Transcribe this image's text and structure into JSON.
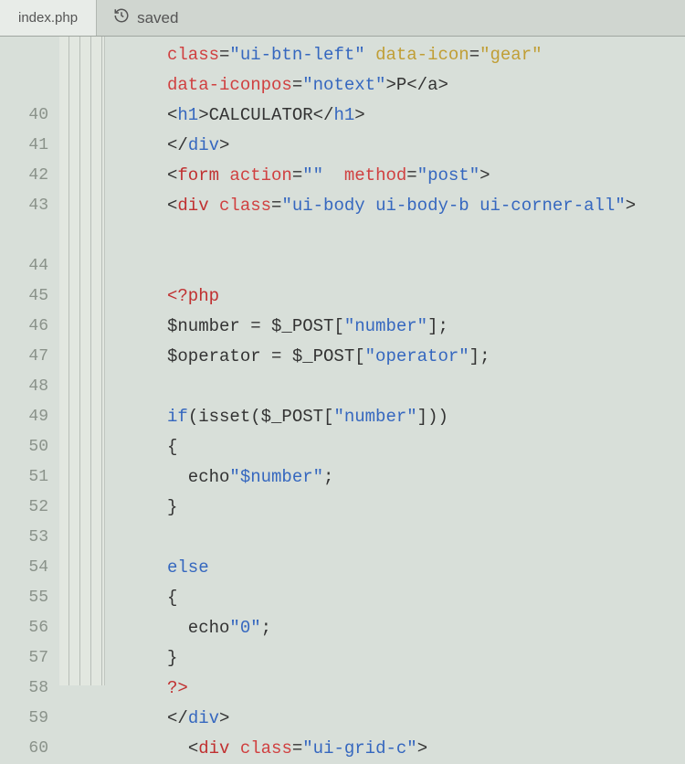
{
  "tab": {
    "filename": "index.php"
  },
  "status": {
    "label": "saved"
  },
  "gutter": {
    "blanks_before": 2,
    "start": 40,
    "end": 60
  },
  "code": {
    "lines": [
      {
        "n": null,
        "frags": [
          {
            "c": "tok-attr",
            "t": "class"
          },
          {
            "c": "tok-punct",
            "t": "="
          },
          {
            "c": "tok-val",
            "t": "\"ui-btn-left\""
          },
          {
            "c": "tok-punct",
            "t": " "
          },
          {
            "c": "tok-attr2",
            "t": "data-icon"
          },
          {
            "c": "tok-punct",
            "t": "="
          },
          {
            "c": "tok-attr2",
            "t": "\"gear\""
          }
        ]
      },
      {
        "n": null,
        "frags": [
          {
            "c": "tok-attr",
            "t": "data-iconpos"
          },
          {
            "c": "tok-punct",
            "t": "="
          },
          {
            "c": "tok-val",
            "t": "\"notext\""
          },
          {
            "c": "tok-bracket",
            "t": ">"
          },
          {
            "c": "tok-text",
            "t": "P"
          },
          {
            "c": "tok-bracket",
            "t": "</"
          },
          {
            "c": "tok-text",
            "t": "a"
          },
          {
            "c": "tok-bracket",
            "t": ">"
          }
        ]
      },
      {
        "n": 40,
        "frags": [
          {
            "c": "tok-bracket",
            "t": "<"
          },
          {
            "c": "tok-tag",
            "t": "h1"
          },
          {
            "c": "tok-bracket",
            "t": ">"
          },
          {
            "c": "tok-text",
            "t": "CALCULATOR"
          },
          {
            "c": "tok-bracket",
            "t": "</"
          },
          {
            "c": "tok-tag",
            "t": "h1"
          },
          {
            "c": "tok-bracket",
            "t": ">"
          }
        ]
      },
      {
        "n": 41,
        "frags": [
          {
            "c": "tok-bracket",
            "t": "</"
          },
          {
            "c": "tok-tag",
            "t": "div"
          },
          {
            "c": "tok-bracket",
            "t": ">"
          }
        ]
      },
      {
        "n": 42,
        "frags": [
          {
            "c": "tok-bracket",
            "t": "<"
          },
          {
            "c": "tok-tagname",
            "t": "form"
          },
          {
            "c": "tok-punct",
            "t": " "
          },
          {
            "c": "tok-attr",
            "t": "action"
          },
          {
            "c": "tok-punct",
            "t": "="
          },
          {
            "c": "tok-val",
            "t": "\"\""
          },
          {
            "c": "tok-punct",
            "t": "  "
          },
          {
            "c": "tok-attr",
            "t": "method"
          },
          {
            "c": "tok-punct",
            "t": "="
          },
          {
            "c": "tok-val",
            "t": "\"post\""
          },
          {
            "c": "tok-bracket",
            "t": ">"
          }
        ]
      },
      {
        "n": 43,
        "tall": true,
        "frags": [
          {
            "c": "tok-bracket",
            "t": "<"
          },
          {
            "c": "tok-tagname",
            "t": "div"
          },
          {
            "c": "tok-punct",
            "t": " "
          },
          {
            "c": "tok-attr",
            "t": "class"
          },
          {
            "c": "tok-punct",
            "t": "="
          },
          {
            "c": "tok-val",
            "t": "\"ui-body ui-body-b ui-corner-all\""
          },
          {
            "c": "tok-bracket",
            "t": ">"
          }
        ]
      },
      {
        "n": 44,
        "frags": []
      },
      {
        "n": 45,
        "frags": [
          {
            "c": "tok-php",
            "t": "<?php"
          }
        ]
      },
      {
        "n": 46,
        "frags": [
          {
            "c": "tok-var",
            "t": "$number = $_POST["
          },
          {
            "c": "tok-str",
            "t": "\"number\""
          },
          {
            "c": "tok-var",
            "t": "];"
          }
        ]
      },
      {
        "n": 47,
        "frags": [
          {
            "c": "tok-var",
            "t": "$operator = $_POST["
          },
          {
            "c": "tok-str",
            "t": "\"operator\""
          },
          {
            "c": "tok-var",
            "t": "];"
          }
        ]
      },
      {
        "n": 48,
        "frags": []
      },
      {
        "n": 49,
        "frags": [
          {
            "c": "tok-keyword",
            "t": "if"
          },
          {
            "c": "tok-var",
            "t": "(isset($_POST["
          },
          {
            "c": "tok-str",
            "t": "\"number\""
          },
          {
            "c": "tok-var",
            "t": "]))"
          }
        ]
      },
      {
        "n": 50,
        "frags": [
          {
            "c": "tok-var",
            "t": "{"
          }
        ]
      },
      {
        "n": 51,
        "frags": [
          {
            "c": "tok-var",
            "t": "  echo"
          },
          {
            "c": "tok-str",
            "t": "\"$number\""
          },
          {
            "c": "tok-var",
            "t": ";"
          }
        ]
      },
      {
        "n": 52,
        "frags": [
          {
            "c": "tok-var",
            "t": "}"
          }
        ]
      },
      {
        "n": 53,
        "frags": []
      },
      {
        "n": 54,
        "frags": [
          {
            "c": "tok-keyword",
            "t": "else"
          }
        ]
      },
      {
        "n": 55,
        "frags": [
          {
            "c": "tok-var",
            "t": "{"
          }
        ]
      },
      {
        "n": 56,
        "frags": [
          {
            "c": "tok-var",
            "t": "  echo"
          },
          {
            "c": "tok-str",
            "t": "\"0\""
          },
          {
            "c": "tok-var",
            "t": ";"
          }
        ]
      },
      {
        "n": 57,
        "frags": [
          {
            "c": "tok-var",
            "t": "}"
          }
        ]
      },
      {
        "n": 58,
        "frags": [
          {
            "c": "tok-php",
            "t": "?>"
          }
        ]
      },
      {
        "n": 59,
        "frags": [
          {
            "c": "tok-bracket",
            "t": "</"
          },
          {
            "c": "tok-tag",
            "t": "div"
          },
          {
            "c": "tok-bracket",
            "t": ">"
          }
        ]
      },
      {
        "n": 60,
        "frags": [
          {
            "c": "tok-punct",
            "t": "  "
          },
          {
            "c": "tok-bracket",
            "t": "<"
          },
          {
            "c": "tok-tagname",
            "t": "div"
          },
          {
            "c": "tok-punct",
            "t": " "
          },
          {
            "c": "tok-attr",
            "t": "class"
          },
          {
            "c": "tok-punct",
            "t": "="
          },
          {
            "c": "tok-val",
            "t": "\"ui-grid-c\""
          },
          {
            "c": "tok-bracket",
            "t": ">"
          }
        ]
      }
    ]
  }
}
